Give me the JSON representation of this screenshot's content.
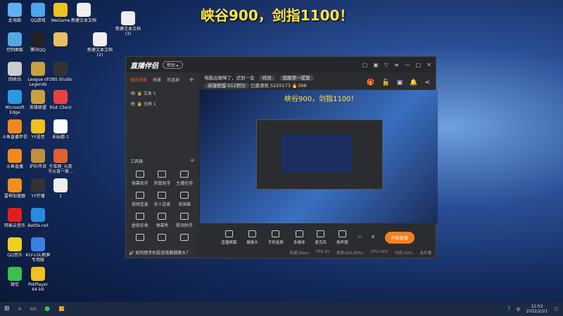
{
  "overlay_title": "峡谷900，剑指1100！",
  "desktop_icons": [
    {
      "label": "此电脑",
      "color": "#5fb0f0"
    },
    {
      "label": "QQ游戏",
      "color": "#4aa6e8"
    },
    {
      "label": "WeGame",
      "color": "#f0c020"
    },
    {
      "label": "新建文本文档",
      "color": "#eee"
    },
    {
      "label": "新建文本文档 (3)",
      "color": "#eee"
    },
    {
      "label": "控制面板",
      "color": "#55a8e0"
    },
    {
      "label": "腾讯QQ",
      "color": "#222"
    },
    {
      "label": ".",
      "color": "#e8c060"
    },
    {
      "label": "新建文本文档 (2)",
      "color": "#eee"
    },
    {
      "label": "回收站",
      "color": "#ccc"
    },
    {
      "label": "League of Legends",
      "color": "#c9a040"
    },
    {
      "label": "OBS Studio",
      "color": "#333"
    },
    {
      "label": "Microsoft Edge",
      "color": "#2a9ae0"
    },
    {
      "label": "英雄联盟",
      "color": "#c9a040"
    },
    {
      "label": "Riot Client",
      "color": "#e84040"
    },
    {
      "label": "斗鱼直播伴侣",
      "color": "#f08a20"
    },
    {
      "label": "YY语音",
      "color": "#f0c020"
    },
    {
      "label": "未标题-1",
      "color": "#fff"
    },
    {
      "label": "斗鱼直播",
      "color": "#f08a20"
    },
    {
      "label": "炉石传说",
      "color": "#c09040"
    },
    {
      "label": "千库网_元宵节元宵一家...",
      "color": "#e06030"
    },
    {
      "label": "雷神加速器",
      "color": "#f09020"
    },
    {
      "label": "YY开播",
      "color": "#333"
    },
    {
      "label": "1",
      "color": "#eee"
    },
    {
      "label": "网易云音乐",
      "color": "#e02020"
    },
    {
      "label": "Battle.net",
      "color": "#2a8ae0"
    },
    {
      "label": "QQ音乐",
      "color": "#f0d020"
    },
    {
      "label": "KLY-LOL刷屏专用版",
      "color": "#3a80e0"
    },
    {
      "label": "微信",
      "color": "#3ac050"
    },
    {
      "label": "PotPlayer 64 bit",
      "color": "#f0c020"
    }
  ],
  "app": {
    "logo": "直播伴侣",
    "badge": "帮助 ▸",
    "window_controls": [
      "▢",
      "▣",
      "▽",
      "≡",
      "—",
      "□",
      "✕"
    ],
    "tabs": [
      "我的场景",
      "场景",
      "可选项"
    ],
    "add": "+",
    "scenes": [
      "文本 1",
      "全屏 1"
    ],
    "tools_title": "工具箱",
    "tools": [
      "弹幕助手",
      "房管助手",
      "主播任务",
      "视频连麦",
      "多人连麦",
      "读弹幕",
      "虚拟形象",
      "弹幕秀",
      "歌词助手",
      "",
      "",
      ""
    ],
    "tip": "如何把手机投成电脑摄像头？",
    "room_title": "电脑出故障了，迟到一会",
    "edit": "修改",
    "category": "英雄联盟-S12积分",
    "tag": "国服第一提莫",
    "fans_label": "已邀请观",
    "fans": "5220173",
    "hot": "398",
    "preview_text": "峡谷900，剑指1100！",
    "bottom_buttons": [
      "直播屏幕",
      "摄像头",
      "手机投屏",
      "多媒体",
      "麦克风",
      "扬声器"
    ],
    "start_label": "开始直播",
    "status": [
      "网速:0kb/s",
      "FPS:30",
      "丢帧:0(0.00%)",
      "CPU:14%",
      "内存:32%",
      "未开播"
    ]
  },
  "taskbar": {
    "time": "12:02",
    "date": "2022/2/21",
    "ime": "中"
  }
}
